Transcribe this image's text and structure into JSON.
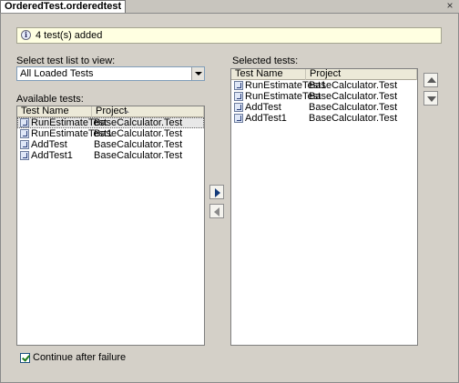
{
  "tab": {
    "title": "OrderedTest.orderedtest",
    "close_glyph": "×"
  },
  "info": {
    "message": "4 test(s) added",
    "icon": "info-icon"
  },
  "left": {
    "select_label": "Select test list to view:",
    "select_value": "All Loaded Tests",
    "available_label": "Available tests:",
    "columns": [
      "Test Name",
      "Project"
    ],
    "rows": [
      {
        "name": "RunEstimateTest",
        "project": "BaseCalculator.Test",
        "selected": true
      },
      {
        "name": "RunEstimateTest1",
        "project": "BaseCalculator.Test",
        "selected": false
      },
      {
        "name": "AddTest",
        "project": "BaseCalculator.Test",
        "selected": false
      },
      {
        "name": "AddTest1",
        "project": "BaseCalculator.Test",
        "selected": false
      }
    ]
  },
  "right": {
    "selected_label": "Selected tests:",
    "columns": [
      "Test Name",
      "Project"
    ],
    "rows": [
      {
        "name": "RunEstimateTest1",
        "project": "BaseCalculator.Test"
      },
      {
        "name": "RunEstimateTest",
        "project": "BaseCalculator.Test"
      },
      {
        "name": "AddTest",
        "project": "BaseCalculator.Test"
      },
      {
        "name": "AddTest1",
        "project": "BaseCalculator.Test"
      }
    ]
  },
  "footer": {
    "continue_label": "Continue after failure",
    "continue_checked": true
  }
}
